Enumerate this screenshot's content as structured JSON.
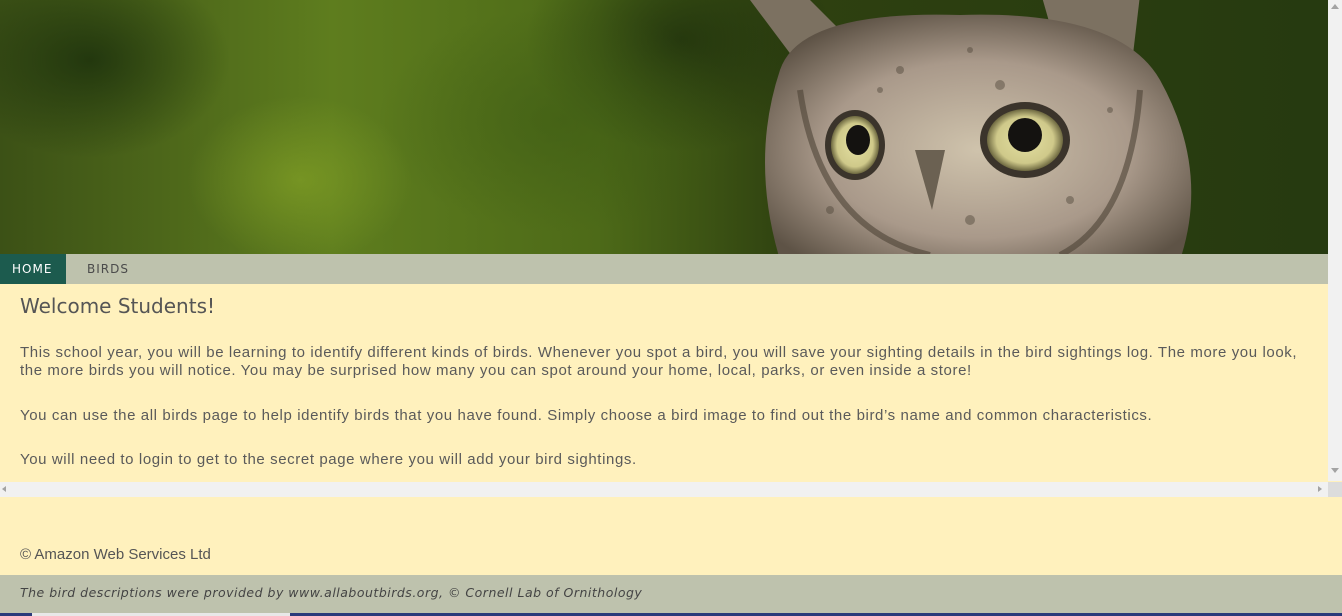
{
  "nav": {
    "items": [
      {
        "label": "HOME",
        "active": true
      },
      {
        "label": "BIRDS",
        "active": false
      }
    ]
  },
  "content": {
    "heading": "Welcome Students!",
    "paragraphs": [
      "This school year, you will be learning to identify different kinds of birds. Whenever you spot a bird, you will save your sighting details in the bird sightings log. The more you look, the more birds you will notice. You may be surprised how many you can spot around your home, local, parks, or even inside a store!",
      "You can use the all birds page to help identify birds that you have found. Simply choose a bird image to find out the bird’s name and common characteristics.",
      "You will need to login to get to the secret page where you will add your bird sightings."
    ]
  },
  "footer": {
    "copyright": "© Amazon Web Services Ltd",
    "credit": "The bird descriptions were provided by www.allaboutbirds.org, © Cornell Lab of Ornithology"
  },
  "colors": {
    "nav_active": "#1c5b4e",
    "nav_bg": "#bec2ad",
    "content_bg": "#fff1bd"
  }
}
